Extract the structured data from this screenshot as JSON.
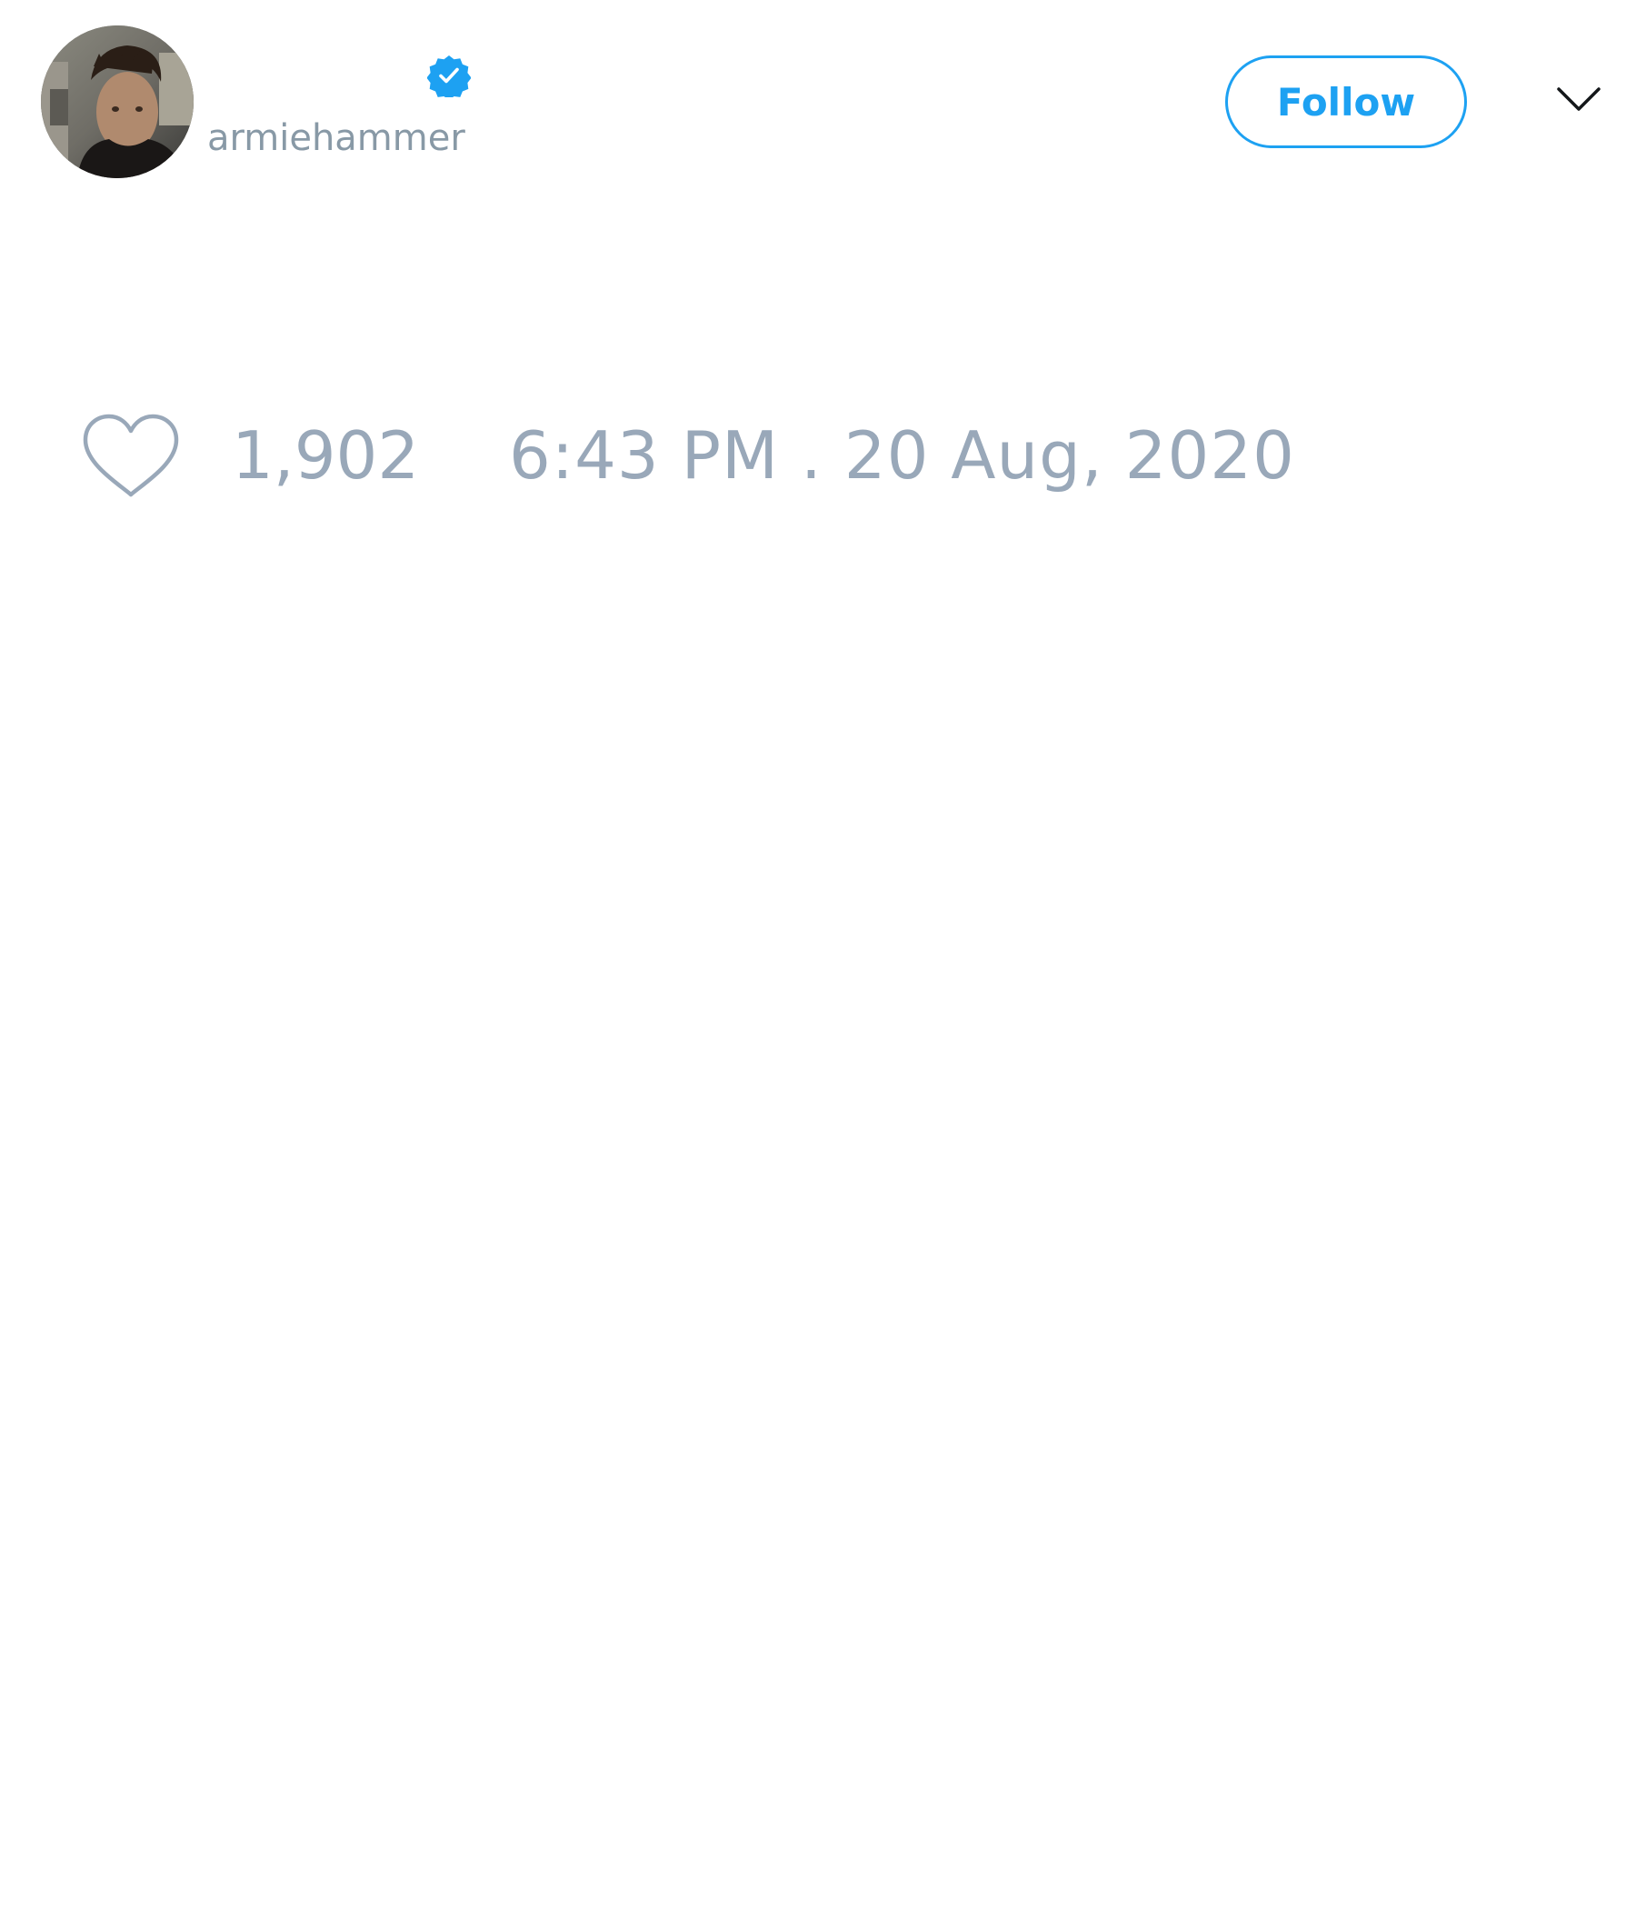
{
  "tweet": {
    "author": {
      "handle": "armiehammer",
      "verified": true,
      "avatar_icon": "profile-photo"
    },
    "follow_label": "Follow",
    "menu_icon": "chevron-down-icon",
    "like_icon": "heart-outline-icon",
    "like_count": "1,902",
    "timestamp": "6:43 PM . 20 Aug, 2020"
  },
  "colors": {
    "accent": "#1da1f2",
    "muted_text": "#8899a6",
    "meta_text": "#99a8b9",
    "background": "#ffffff"
  }
}
